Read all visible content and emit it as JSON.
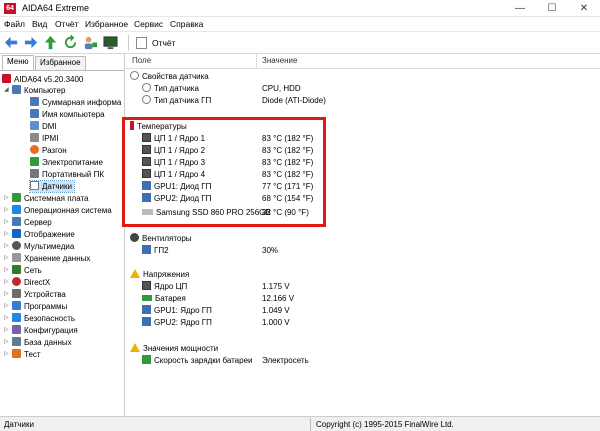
{
  "window": {
    "app_icon_text": "64",
    "title": "AIDA64 Extreme",
    "minimize": "—",
    "maximize": "☐",
    "close": "✕"
  },
  "menu": [
    "Файл",
    "Вид",
    "Отчёт",
    "Избранное",
    "Сервис",
    "Справка"
  ],
  "toolbar": {
    "report_label": "Отчёт"
  },
  "tabs": {
    "menu": "Меню",
    "favorites": "Избранное"
  },
  "tree": {
    "root": "AIDA64 v5.20.3400",
    "computer": "Компьютер",
    "computer_children": [
      "Суммарная информа",
      "Имя компьютера",
      "DMI",
      "IPMI",
      "Разгон",
      "Электропитание",
      "Портативный ПК",
      "Датчики"
    ],
    "items": [
      "Системная плата",
      "Операционная система",
      "Сервер",
      "Отображение",
      "Мультимедиа",
      "Хранение данных",
      "Сеть",
      "DirectX",
      "Устройства",
      "Программы",
      "Безопасность",
      "Конфигурация",
      "База данных",
      "Тест"
    ]
  },
  "columns": {
    "field": "Поле",
    "value": "Значение"
  },
  "sensor_props": {
    "title": "Свойства датчика",
    "rows": [
      {
        "field": "Тип датчика",
        "value": "CPU, HDD"
      },
      {
        "field": "Тип датчика ГП",
        "value": "Diode  (ATI-Diode)"
      }
    ]
  },
  "temperatures": {
    "title": "Температуры",
    "rows": [
      {
        "field": "ЦП 1 / Ядро 1",
        "value": "83 °C  (182 °F)"
      },
      {
        "field": "ЦП 1 / Ядро 2",
        "value": "83 °C  (182 °F)"
      },
      {
        "field": "ЦП 1 / Ядро 3",
        "value": "83 °C  (182 °F)"
      },
      {
        "field": "ЦП 1 / Ядро 4",
        "value": "83 °C  (182 °F)"
      },
      {
        "field": "GPU1: Диод ГП",
        "value": "77 °C  (171 °F)"
      },
      {
        "field": "GPU2: Диод ГП",
        "value": "68 °C  (154 °F)"
      },
      {
        "field": "Samsung SSD 860 PRO 256GB",
        "value": "32 °C  (90 °F)"
      }
    ]
  },
  "fans": {
    "title": "Вентиляторы",
    "rows": [
      {
        "field": "ГП2",
        "value": "30%"
      }
    ]
  },
  "voltages": {
    "title": "Напряжения",
    "rows": [
      {
        "field": "Ядро ЦП",
        "value": "1.175 V"
      },
      {
        "field": "Батарея",
        "value": "12.166 V"
      },
      {
        "field": "GPU1: Ядро ГП",
        "value": "1.049 V"
      },
      {
        "field": "GPU2: Ядро ГП",
        "value": "1.000 V"
      }
    ]
  },
  "power": {
    "title": "Значения мощности",
    "rows": [
      {
        "field": "Скорость зарядки батареи",
        "value": "Электросеть"
      }
    ]
  },
  "status": {
    "left": "Датчики",
    "right": "Copyright (c) 1995-2015 FinalWire Ltd."
  },
  "colors": {
    "highlight": "#e01818",
    "selection": "#cce4f7",
    "brand": "#c8102e"
  }
}
